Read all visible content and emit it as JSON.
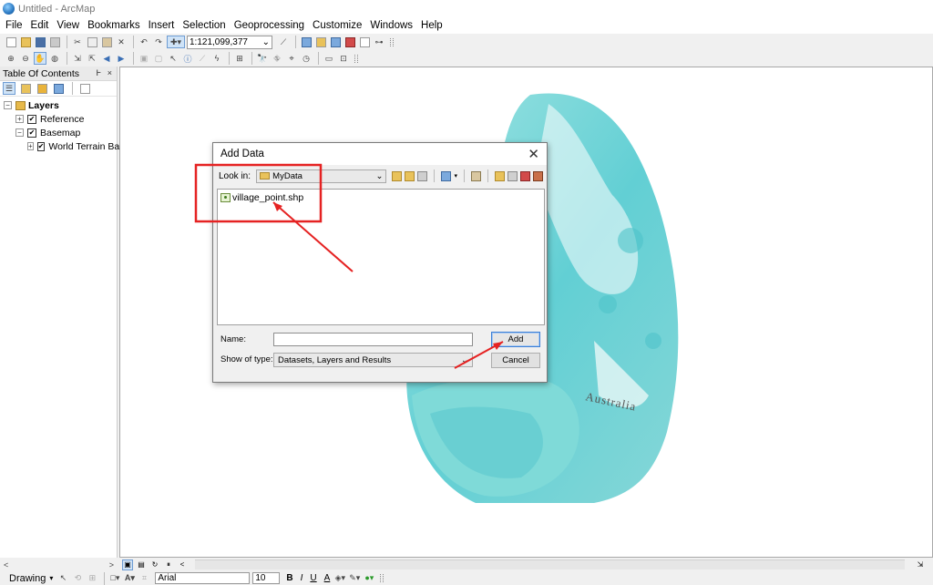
{
  "window": {
    "title": "Untitled - ArcMap"
  },
  "menu": [
    "File",
    "Edit",
    "View",
    "Bookmarks",
    "Insert",
    "Selection",
    "Geoprocessing",
    "Customize",
    "Windows",
    "Help"
  ],
  "toolbar": {
    "scale": "1:121,099,377"
  },
  "toc": {
    "title": "Table Of Contents",
    "pin_close": "Ͱ ×",
    "root": "Layers",
    "items": [
      {
        "label": "Reference",
        "expand": "+",
        "checked": true
      },
      {
        "label": "Basemap",
        "expand": "−",
        "checked": true
      },
      {
        "label": "World Terrain Ba",
        "expand": "+",
        "checked": true
      }
    ]
  },
  "map": {
    "label": "Australia",
    "ocean_color": "#6fd0d5",
    "land_color": "#ffffff"
  },
  "dialog": {
    "title": "Add Data",
    "close": "✕",
    "lookin_label": "Look in:",
    "lookin_value": "MyData",
    "files": [
      "village_point.shp"
    ],
    "name_label": "Name:",
    "name_value": "",
    "type_label": "Show of type:",
    "type_value": "Datasets, Layers and Results",
    "add_label": "Add",
    "cancel_label": "Cancel"
  },
  "status": {
    "drawing": "Drawing",
    "font": "Arial",
    "size": "10",
    "bold": "B",
    "italic": "I",
    "underline": "U",
    "font_color": "A"
  },
  "annotation_color": "#e52222"
}
